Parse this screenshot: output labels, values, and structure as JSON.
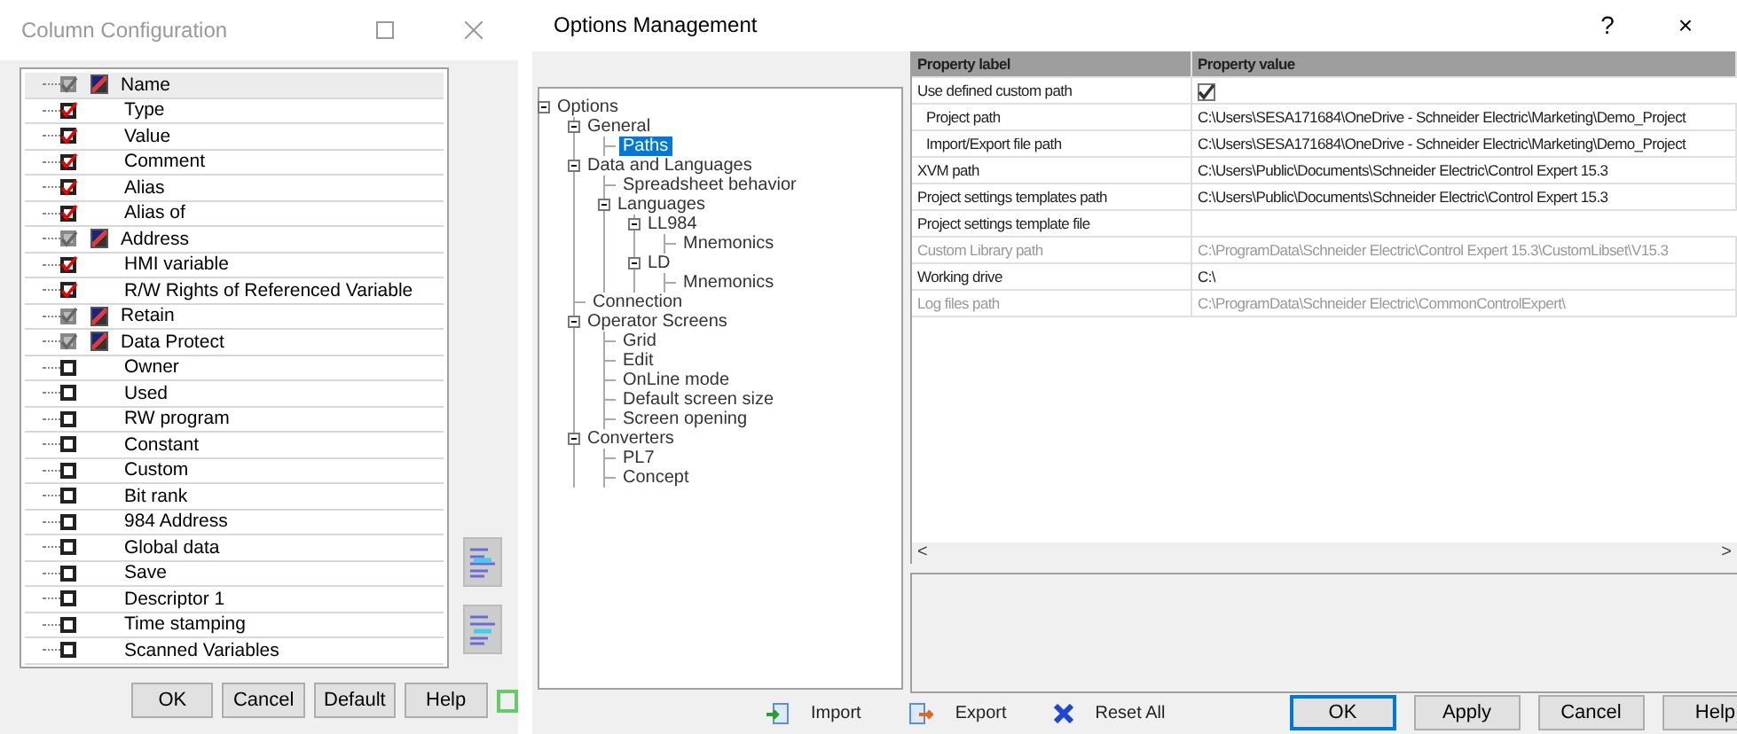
{
  "column_window": {
    "title": "Column Configuration",
    "columns": [
      {
        "label": "Name",
        "checked": true,
        "disabled": true,
        "flagged": true
      },
      {
        "label": "Type",
        "checked": true,
        "disabled": false,
        "flagged": false
      },
      {
        "label": "Value",
        "checked": true,
        "disabled": false,
        "flagged": false
      },
      {
        "label": "Comment",
        "checked": true,
        "disabled": false,
        "flagged": false
      },
      {
        "label": "Alias",
        "checked": true,
        "disabled": false,
        "flagged": false
      },
      {
        "label": "Alias of",
        "checked": true,
        "disabled": false,
        "flagged": false
      },
      {
        "label": "Address",
        "checked": true,
        "disabled": true,
        "flagged": true
      },
      {
        "label": "HMI variable",
        "checked": true,
        "disabled": false,
        "flagged": false
      },
      {
        "label": "R/W Rights of Referenced Variable",
        "checked": true,
        "disabled": false,
        "flagged": false
      },
      {
        "label": "Retain",
        "checked": true,
        "disabled": true,
        "flagged": true
      },
      {
        "label": "Data Protect",
        "checked": true,
        "disabled": true,
        "flagged": true
      },
      {
        "label": "Owner",
        "checked": false,
        "disabled": false,
        "flagged": false
      },
      {
        "label": "Used",
        "checked": false,
        "disabled": false,
        "flagged": false
      },
      {
        "label": "RW program",
        "checked": false,
        "disabled": false,
        "flagged": false
      },
      {
        "label": "Constant",
        "checked": false,
        "disabled": false,
        "flagged": false
      },
      {
        "label": "Custom",
        "checked": false,
        "disabled": false,
        "flagged": false
      },
      {
        "label": "Bit rank",
        "checked": false,
        "disabled": false,
        "flagged": false
      },
      {
        "label": "984 Address",
        "checked": false,
        "disabled": false,
        "flagged": false
      },
      {
        "label": "Global data",
        "checked": false,
        "disabled": false,
        "flagged": false
      },
      {
        "label": "Save",
        "checked": false,
        "disabled": false,
        "flagged": false
      },
      {
        "label": "Descriptor 1",
        "checked": false,
        "disabled": false,
        "flagged": false
      },
      {
        "label": "Time stamping",
        "checked": false,
        "disabled": false,
        "flagged": false
      },
      {
        "label": "Scanned Variables",
        "checked": false,
        "disabled": false,
        "flagged": false
      }
    ],
    "buttons": [
      "OK",
      "Cancel",
      "Default",
      "Help"
    ]
  },
  "options_window": {
    "title": "Options Management",
    "help": "?",
    "close": "×",
    "tree": [
      {
        "label": "Options",
        "expanded": true,
        "selected": false,
        "children": [
          {
            "label": "General",
            "expanded": true,
            "selected": false,
            "children": [
              {
                "label": "Paths",
                "selected": true
              }
            ]
          },
          {
            "label": "Data and Languages",
            "expanded": true,
            "selected": false,
            "children": [
              {
                "label": "Spreadsheet behavior",
                "selected": false
              },
              {
                "label": "Languages",
                "expanded": true,
                "selected": false,
                "children": [
                  {
                    "label": "LL984",
                    "expanded": true,
                    "selected": false,
                    "children": [
                      {
                        "label": "Mnemonics",
                        "selected": false
                      }
                    ]
                  },
                  {
                    "label": "LD",
                    "expanded": true,
                    "selected": false,
                    "children": [
                      {
                        "label": "Mnemonics",
                        "selected": false
                      }
                    ]
                  }
                ]
              }
            ]
          },
          {
            "label": "Connection",
            "selected": false
          },
          {
            "label": "Operator Screens",
            "expanded": true,
            "selected": false,
            "children": [
              {
                "label": "Grid",
                "selected": false
              },
              {
                "label": "Edit",
                "selected": false
              },
              {
                "label": "OnLine mode",
                "selected": false
              },
              {
                "label": "Default screen size",
                "selected": false
              },
              {
                "label": "Screen opening",
                "selected": false
              }
            ]
          },
          {
            "label": "Converters",
            "expanded": true,
            "selected": false,
            "children": [
              {
                "label": "PL7",
                "selected": false
              },
              {
                "label": "Concept",
                "selected": false
              }
            ]
          }
        ]
      }
    ],
    "grid": {
      "columns": [
        "Property label",
        "Property value"
      ],
      "rows": [
        {
          "label": "Use defined custom path",
          "kind": "checkbox",
          "checked": true,
          "disabled": false,
          "children": [
            {
              "label": "Project path",
              "kind": "text",
              "value": "C:\\Users\\SESA171684\\OneDrive - Schneider Electric\\Marketing\\Demo_Project",
              "disabled": false
            },
            {
              "label": "Import/Export file path",
              "kind": "text",
              "value": "C:\\Users\\SESA171684\\OneDrive - Schneider Electric\\Marketing\\Demo_Project",
              "disabled": false
            }
          ]
        },
        {
          "label": "XVM path",
          "kind": "text",
          "value": "C:\\Users\\Public\\Documents\\Schneider Electric\\Control Expert 15.3",
          "disabled": false
        },
        {
          "label": "Project settings templates path",
          "kind": "text",
          "value": "C:\\Users\\Public\\Documents\\Schneider Electric\\Control Expert 15.3",
          "disabled": false
        },
        {
          "label": "Project settings template file",
          "kind": "text",
          "disabled": false
        },
        {
          "label": "Custom Library path",
          "kind": "text",
          "value": "C:\\ProgramData\\Schneider Electric\\Control Expert 15.3\\CustomLibset\\V15.3",
          "disabled": true
        },
        {
          "label": "Working drive",
          "kind": "text",
          "value": "C:\\",
          "disabled": false
        },
        {
          "label": "Log files path",
          "kind": "text",
          "value": "C:\\ProgramData\\Schneider Electric\\CommonControlExpert\\",
          "disabled": true
        }
      ]
    },
    "scroll_left": "<",
    "scroll_right": ">",
    "actions": [
      {
        "kind": "import",
        "label": "Import"
      },
      {
        "kind": "export",
        "label": "Export"
      },
      {
        "kind": "reset",
        "label": "Reset All"
      }
    ],
    "buttons": [
      {
        "label": "OK",
        "selected": true
      },
      {
        "label": "Apply",
        "selected": false
      },
      {
        "label": "Cancel",
        "selected": false
      },
      {
        "label": "Help",
        "selected": false
      }
    ]
  }
}
